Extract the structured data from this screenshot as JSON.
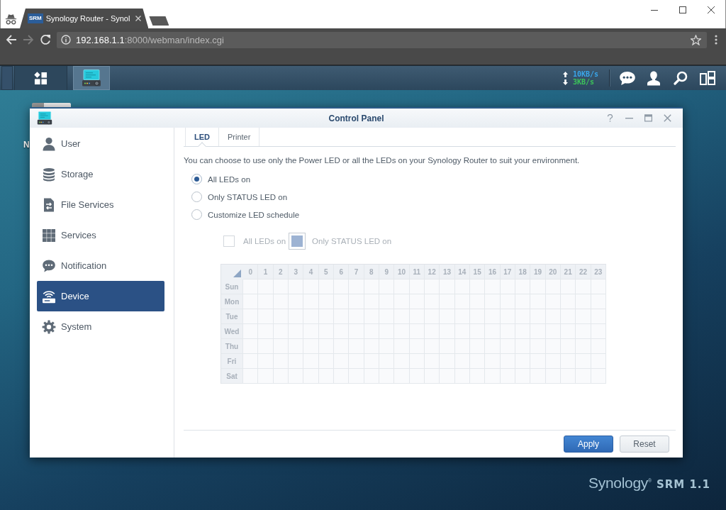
{
  "browser": {
    "tab": {
      "icon_text": "SRM",
      "title": "Synology Router - Synol"
    },
    "nav": [
      {
        "kind": "back",
        "disabled": false
      },
      {
        "kind": "forward",
        "disabled": true
      },
      {
        "kind": "reload",
        "disabled": false
      }
    ],
    "address": {
      "host": "192.168.1.1",
      "path": ":8000/webman/index.cgi"
    }
  },
  "taskbar": {
    "apps": [
      {
        "kind": "control-panel",
        "selected": true
      }
    ],
    "traffic": [
      {
        "kind": "upload",
        "reading": "10KB/s"
      },
      {
        "kind": "download",
        "reading": "3KB/s"
      }
    ]
  },
  "desktop": {
    "icon_label": "N",
    "logo": {
      "wordmark": "Synology$^{®}$",
      "product": "SRM 1.1"
    }
  },
  "window": {
    "title": "Control Panel"
  },
  "sidebar": {
    "items": [
      {
        "kind": "user",
        "label": "User",
        "selected": false
      },
      {
        "kind": "storage",
        "label": "Storage",
        "selected": false
      },
      {
        "kind": "file-services",
        "label": "File Services",
        "selected": false
      },
      {
        "kind": "services",
        "label": "Services",
        "selected": false
      },
      {
        "kind": "notification",
        "label": "Notification",
        "selected": false
      },
      {
        "kind": "device",
        "label": "Device",
        "selected": true
      },
      {
        "kind": "system",
        "label": "System",
        "selected": false
      }
    ]
  },
  "tabs": [
    {
      "label": "LED",
      "selected": true
    },
    {
      "label": "Printer",
      "selected": false
    }
  ],
  "description": "You can choose to use only the Power LED or all the LEDs on your Synology Router to suit your environment.",
  "led_modes": [
    {
      "label": "All LEDs on",
      "selected": true
    },
    {
      "label": "Only STATUS LED on",
      "selected": false
    },
    {
      "label": "Customize LED schedule",
      "selected": false
    }
  ],
  "schedule": {
    "disabled": true,
    "legend": [
      {
        "kind": "all",
        "label": "All LEDs on"
      },
      {
        "kind": "status",
        "label": "Only STATUS LED on"
      }
    ],
    "columns": [
      "0",
      "1",
      "2",
      "3",
      "4",
      "5",
      "6",
      "7",
      "8",
      "9",
      "10",
      "11",
      "12",
      "13",
      "14",
      "15",
      "16",
      "17",
      "18",
      "19",
      "20",
      "21",
      "22",
      "23"
    ],
    "rows": [
      "Sun",
      "Mon",
      "Tue",
      "Wed",
      "Thu",
      "Fri",
      "Sat"
    ]
  },
  "buttons": [
    {
      "kind": "primary",
      "label": "Apply"
    },
    {
      "kind": "secondary",
      "label": "Reset"
    }
  ]
}
